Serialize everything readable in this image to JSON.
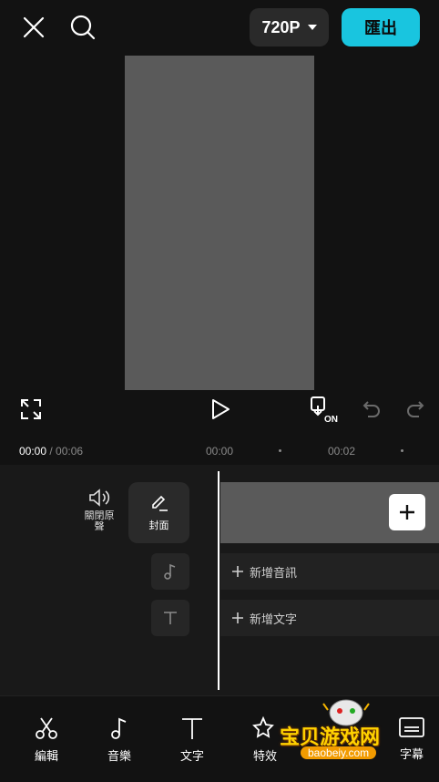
{
  "header": {
    "resolution_label": "720P",
    "export_label": "匯出"
  },
  "timeline": {
    "current_time": "00:00",
    "separator": " / ",
    "total_time": "00:06",
    "ruler": [
      "00:00",
      "00:02"
    ]
  },
  "tracks": {
    "mute_label": "關閉原聲",
    "cover_label": "封面",
    "add_audio_label": "新增音訊",
    "add_text_label": "新增文字"
  },
  "toolbar": {
    "items": [
      {
        "label": "編輯",
        "icon": "scissors-icon"
      },
      {
        "label": "音樂",
        "icon": "music-note-icon"
      },
      {
        "label": "文字",
        "icon": "text-icon"
      },
      {
        "label": "特效",
        "icon": "effects-star-icon"
      },
      {
        "label": "字幕",
        "icon": "subtitles-icon"
      }
    ]
  },
  "watermark": {
    "text": "宝贝游戏网",
    "url": "baobeiy.com"
  },
  "colors": {
    "accent": "#19c5df",
    "background": "#121212",
    "preview": "#5a5a5a"
  }
}
